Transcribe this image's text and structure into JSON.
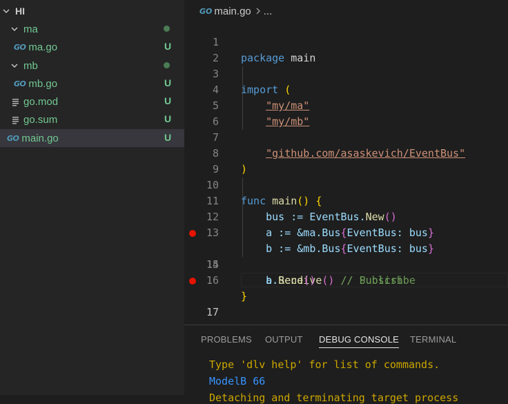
{
  "explorer": {
    "root_label": "HI",
    "items": [
      {
        "label": "ma",
        "status": "dot"
      },
      {
        "label": "ma.go",
        "status": "U",
        "icon": "go-file-icon"
      },
      {
        "label": "mb",
        "status": "dot"
      },
      {
        "label": "mb.go",
        "status": "U",
        "icon": "go-file-icon"
      },
      {
        "label": "go.mod",
        "status": "U",
        "icon": "lines-file-icon"
      },
      {
        "label": "go.sum",
        "status": "U",
        "icon": "lines-file-icon"
      },
      {
        "label": "main.go",
        "status": "U",
        "icon": "go-file-icon"
      }
    ]
  },
  "icons": {
    "go_glyph": "GO"
  },
  "breadcrumb": {
    "file": "main.go",
    "more": "..."
  },
  "editor": {
    "line_numbers": [
      "1",
      "2",
      "3",
      "4",
      "5",
      "6",
      "7",
      "8",
      "9",
      "10",
      "11",
      "12",
      "13",
      "14",
      "15",
      "16",
      "17"
    ],
    "breakpoint_lines": [
      14,
      17
    ],
    "current_line": 17,
    "tokens": {
      "package": "package",
      "main": "main",
      "import": "import",
      "open_paren": "(",
      "close_paren": ")",
      "str_ma": "\"my/ma\"",
      "str_mb": "\"my/mb\"",
      "str_eventbus": "\"github.com/asaskevich/EventBus\"",
      "func": "func",
      "main_fn": "main",
      "fn_parens": "()",
      "open_brace": "{",
      "close_brace": "}",
      "l11_a": "bus := EventBus.",
      "l11_new": "New",
      "l11_parens": "()",
      "l12_a": "a := &ma.Bus",
      "l12_open": "{",
      "l12_mid": "EventBus: bus",
      "l12_close": "}",
      "l13_a": "b := &mb.Bus",
      "l13_open": "{",
      "l13_mid": "EventBus: bus",
      "l13_close": "}",
      "l14_a": "b.",
      "l14_fn": "Receive",
      "l14_parens": "()",
      "l14_cm": "// Subscribe",
      "l15_a": "a.",
      "l15_fn": "Send",
      "l15_parens": "()",
      "l15_cm": "// Publish"
    }
  },
  "panel": {
    "tabs": [
      "PROBLEMS",
      "OUTPUT",
      "DEBUG CONSOLE",
      "TERMINAL"
    ],
    "active_tab": "DEBUG CONSOLE",
    "console": [
      "Type 'dlv help' for list of commands.",
      "ModelB 66",
      "Detaching and terminating target process"
    ]
  },
  "colors": {
    "keyword": "#569cd6",
    "function": "#dcdcaa",
    "string": "#ce9178",
    "comment": "#6a9955",
    "git_untracked": "#73c991",
    "breakpoint": "#e51400"
  }
}
